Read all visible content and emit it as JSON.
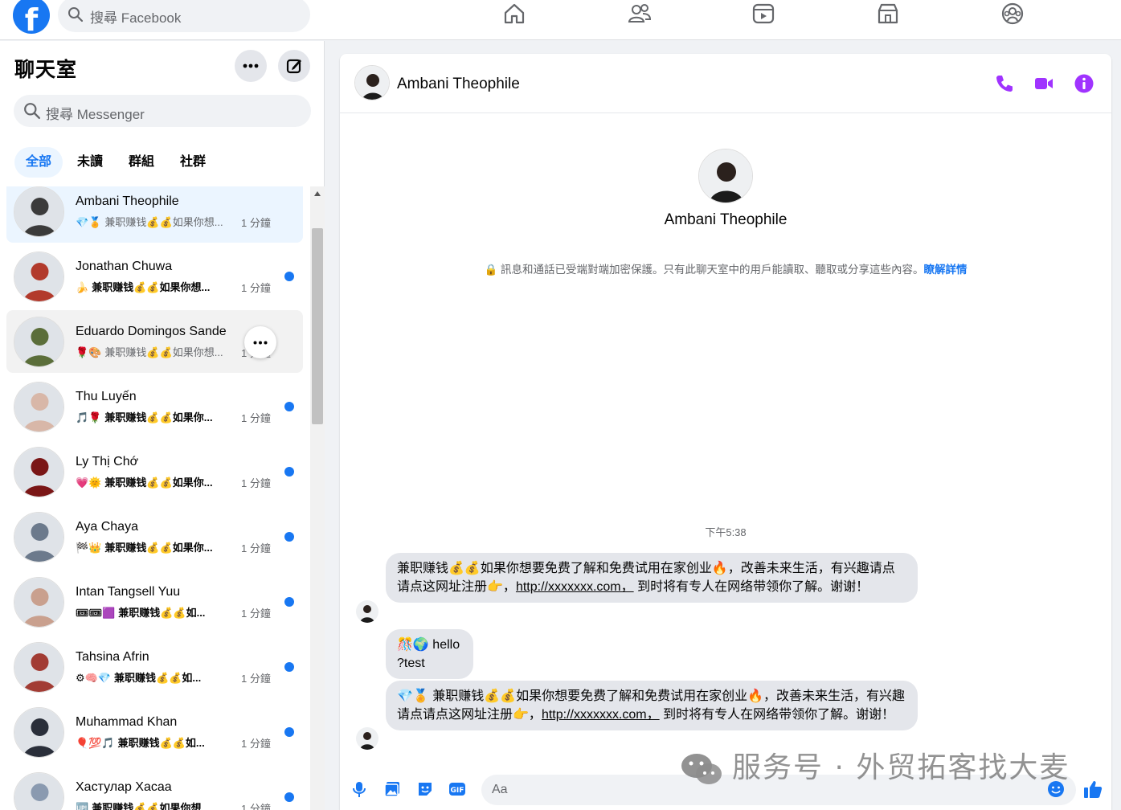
{
  "topbar": {
    "logo": "f",
    "search_placeholder": "搜尋 Facebook",
    "nav_icons": [
      "home-icon",
      "friends-icon",
      "video-icon",
      "marketplace-icon",
      "groups-icon"
    ]
  },
  "sidebar": {
    "title": "聊天室",
    "search_placeholder": "搜尋 Messenger",
    "filters": [
      "全部",
      "未讀",
      "群組",
      "社群"
    ],
    "active_filter": "全部"
  },
  "chats": [
    {
      "name": "Ambani Theophile",
      "emoji": "💎🏅",
      "preview": "兼职赚钱💰💰如果你想...",
      "time": "1 分鐘",
      "unread": false,
      "state": "selected",
      "avatar_color": "#3b3b3b"
    },
    {
      "name": "Jonathan Chuwa",
      "emoji": "🍌",
      "preview": "兼职赚钱💰💰如果你想...",
      "time": "1 分鐘",
      "unread": true,
      "state": "",
      "avatar_color": "#b23a2c"
    },
    {
      "name": "Eduardo Domingos Sande",
      "emoji": "🌹🎨",
      "preview": "兼职赚钱💰💰如果你想...",
      "time": "1 分鐘",
      "unread": false,
      "state": "hover",
      "avatar_color": "#5b6e3a"
    },
    {
      "name": "Thu Luyến",
      "emoji": "🎵🌹",
      "preview": "兼职赚钱💰💰如果你...",
      "time": "1 分鐘",
      "unread": true,
      "state": "",
      "avatar_color": "#d8b7a8"
    },
    {
      "name": "Ly Thị Chớ",
      "emoji": "💗🌞",
      "preview": "兼职赚钱💰💰如果你...",
      "time": "1 分鐘",
      "unread": true,
      "state": "",
      "avatar_color": "#7a1616"
    },
    {
      "name": "Aya Chaya",
      "emoji": "🏁👑",
      "preview": "兼职赚钱💰💰如果你...",
      "time": "1 分鐘",
      "unread": true,
      "state": "",
      "avatar_color": "#6c7a8c"
    },
    {
      "name": "Intan Tangsell Yuu",
      "emoji": "🎟🎟🟪",
      "preview": "兼职赚钱💰💰如...",
      "time": "1 分鐘",
      "unread": true,
      "state": "",
      "avatar_color": "#c9a08e"
    },
    {
      "name": "Tahsina Afrin",
      "emoji": "⚙🧠💎",
      "preview": "兼职赚钱💰💰如...",
      "time": "1 分鐘",
      "unread": true,
      "state": "",
      "avatar_color": "#a23c34"
    },
    {
      "name": "Muhammad Khan",
      "emoji": "🎈💯🎵",
      "preview": "兼职赚钱💰💰如...",
      "time": "1 分鐘",
      "unread": true,
      "state": "",
      "avatar_color": "#2a2f3a"
    },
    {
      "name": "Хастулар Хасаа",
      "emoji": "🆙",
      "preview": "兼职赚钱💰💰如果你想...",
      "time": "1 分鐘",
      "unread": true,
      "state": "",
      "avatar_color": "#8a9ab0"
    }
  ],
  "conversation": {
    "contact_name": "Ambani Theophile",
    "profile_name": "Ambani Theophile",
    "e2e_notice": "🔒 訊息和通話已受端對端加密保護。只有此聊天室中的用戶能讀取、聽取或分享這些內容。",
    "e2e_link": "瞭解詳情",
    "timestamp": "下午5:38",
    "messages": [
      {
        "pre": "兼职赚钱💰💰如果你想要免费了解和免费试用在家创业🔥，改善未来生活，有兴趣请点请点这网址注册👉，",
        "link": "http://xxxxxxx.com，",
        "post": " 到时将有专人在网络带领你了解。谢谢！"
      },
      {
        "pre": "🎊🌍 hello",
        "link": "",
        "post": "?test"
      },
      {
        "pre": "💎🏅 兼职赚钱💰💰如果你想要免费了解和免费试用在家创业🔥，改善未来生活，有兴趣请点请点这网址注册👉，",
        "link": "http://xxxxxxx.com，",
        "post": " 到时将有专人在网络带领你了解。谢谢！"
      }
    ],
    "composer_placeholder": "Aa"
  },
  "watermark": "服务号 · 外贸拓客找大麦",
  "colors": {
    "accent": "#1877f2",
    "messenger_purple": "#a033ff",
    "bubble": "#e4e6eb"
  }
}
